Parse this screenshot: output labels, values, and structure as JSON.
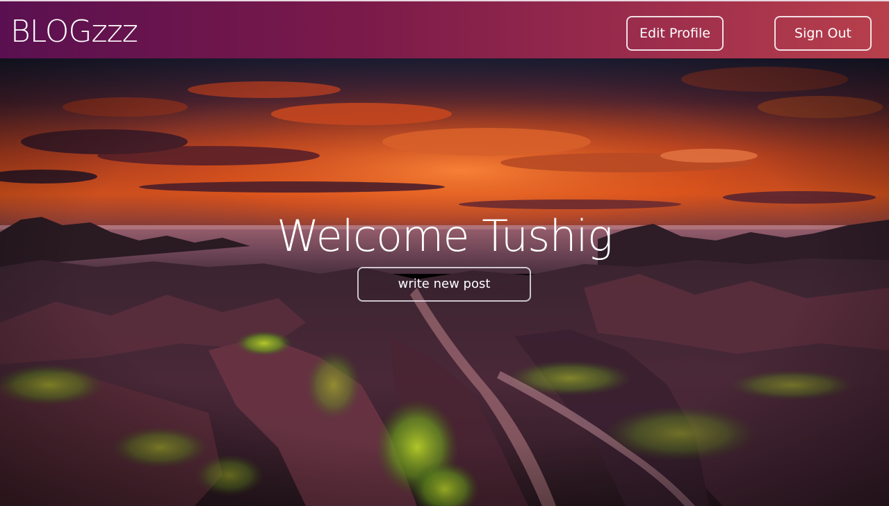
{
  "navbar": {
    "brand": "BLOGzzz",
    "edit_profile_label": "Edit Profile",
    "sign_out_label": "Sign Out",
    "gradient_start": "#5a1050",
    "gradient_end": "#b8404c"
  },
  "hero": {
    "welcome_text": "Welcome Tushig",
    "write_post_label": "write new post"
  }
}
